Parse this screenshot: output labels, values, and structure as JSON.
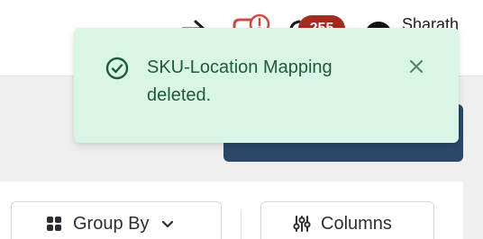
{
  "header": {
    "notification_count": "255",
    "user_name": "Sharath"
  },
  "toolbar": {
    "group_by_label": "Group By",
    "columns_label": "Columns"
  },
  "toast": {
    "message": "SKU-Location Mapping deleted.",
    "status": "success",
    "colors": {
      "background": "#d9f5e5",
      "text": "#1f5a3b"
    }
  },
  "icons": {
    "nav_arrow": "arrow-right-icon",
    "alert": "alert-icon",
    "toast_status": "check-circle-icon",
    "toast_close": "close-icon",
    "group_by": "grid-icon",
    "group_by_menu": "chevron-down-icon",
    "columns": "sliders-icon"
  },
  "colors": {
    "badge": "#a52a20",
    "primary_dark": "#2c4868"
  }
}
